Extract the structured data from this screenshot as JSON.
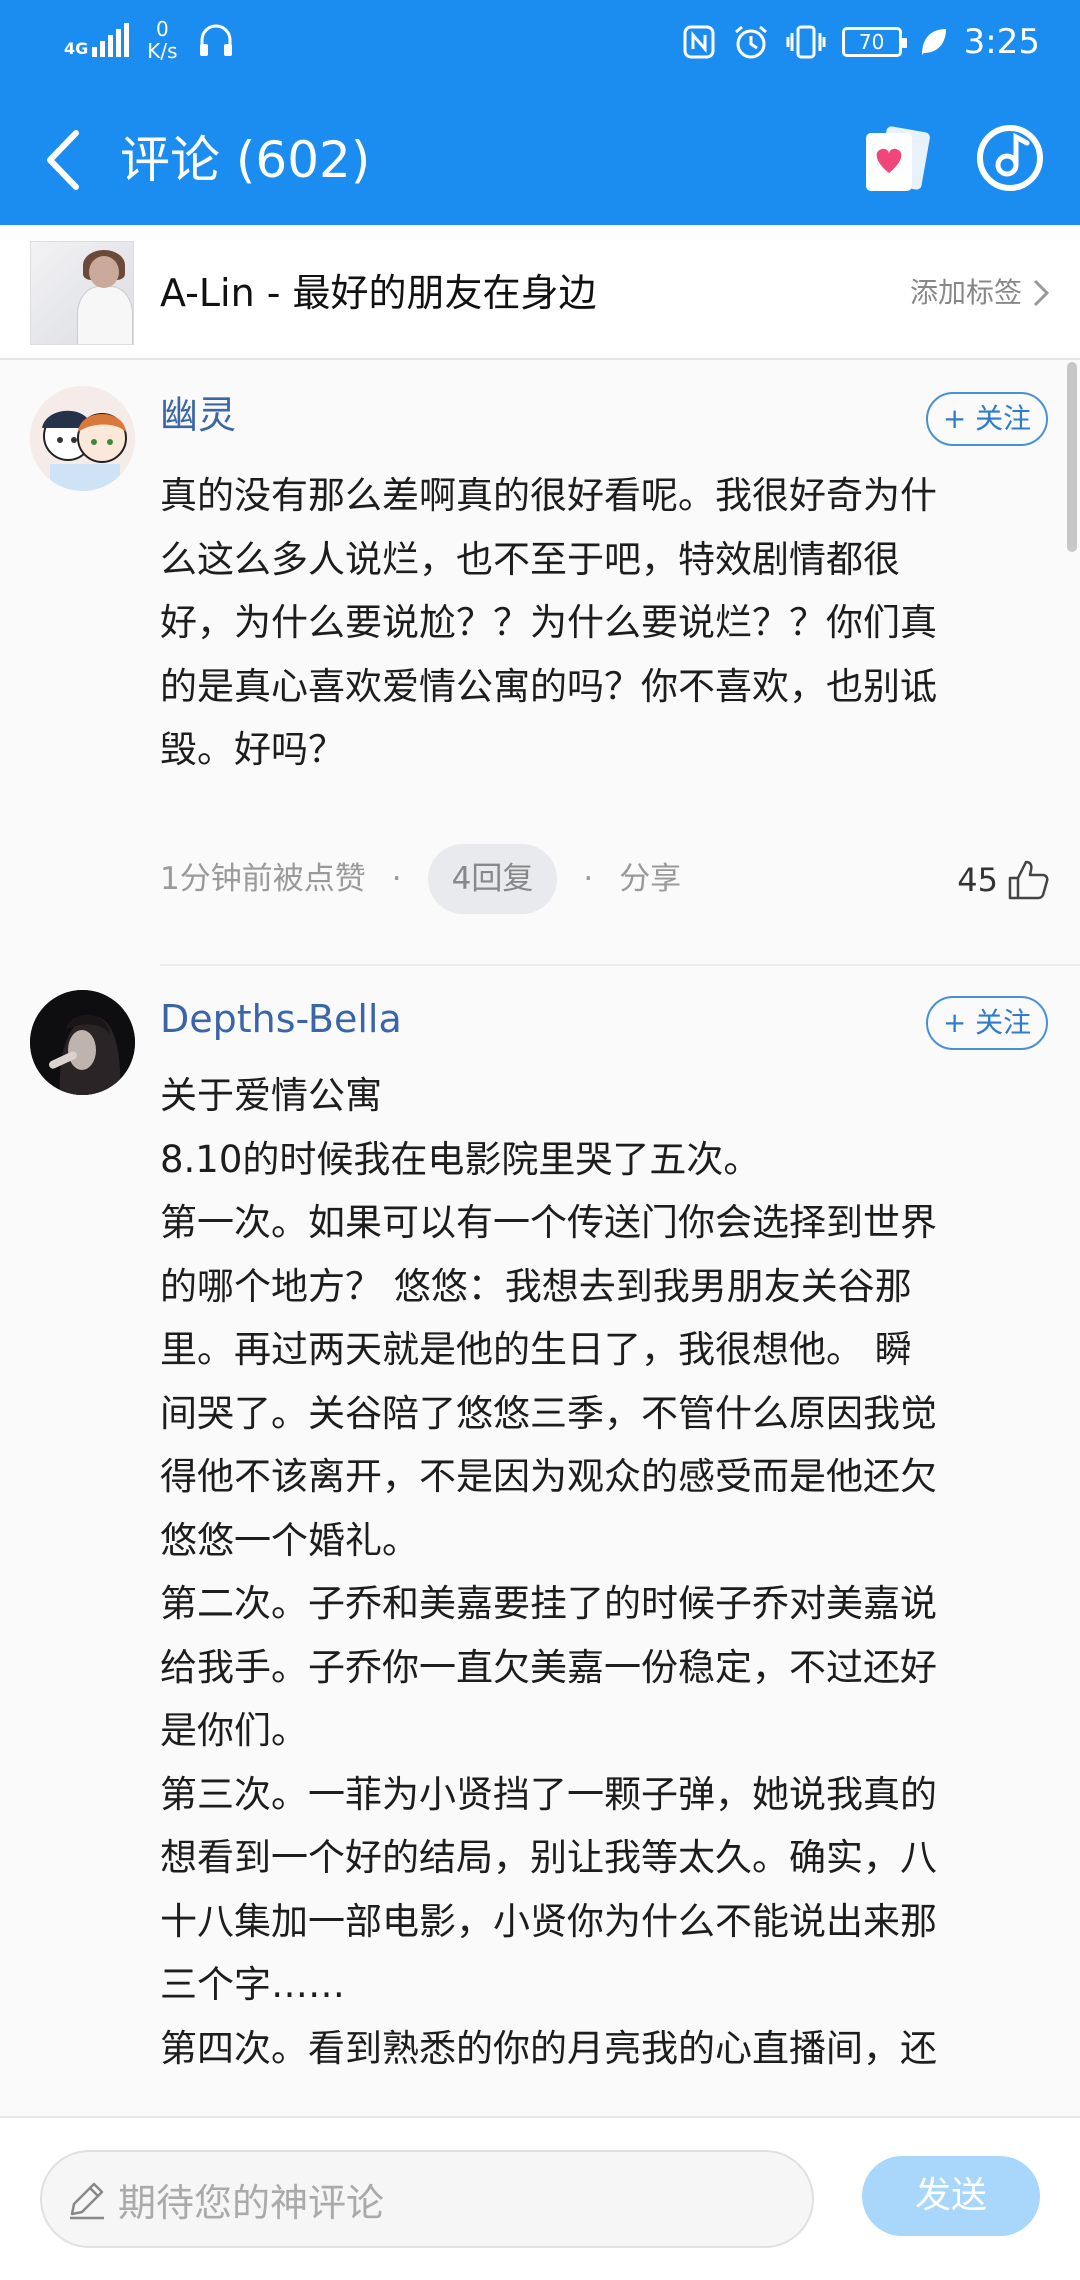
{
  "status_bar": {
    "network": "4G",
    "speed_value": "0",
    "speed_unit": "K/s",
    "battery": "70",
    "time": "3:25"
  },
  "header": {
    "title": "评论 (602)"
  },
  "song": {
    "title": "A-Lin - 最好的朋友在身边",
    "tag_label": "添加标签"
  },
  "comments": [
    {
      "username": "幽灵",
      "follow_label": "+ 关注",
      "lines": [
        "真的没有那么差啊真的很好看呢。我很好奇为什",
        "么这么多人说烂，也不至于吧，特效剧情都很",
        "好，为什么要说尬？？为什么要说烂？？你们真",
        "的是真心喜欢爱情公寓的吗？你不喜欢，也别诋",
        "毁。好吗？"
      ],
      "time": "1分钟前被点赞",
      "reply": "4回复",
      "share": "分享",
      "likes": "45"
    },
    {
      "username": "Depths-Bella",
      "follow_label": "+ 关注",
      "lines": [
        "关于爱情公寓",
        "8.10的时候我在电影院里哭了五次。",
        "第一次。如果可以有一个传送门你会选择到世界",
        "的哪个地方？ 悠悠：我想去到我男朋友关谷那",
        "里。再过两天就是他的生日了，我很想他。 瞬",
        "间哭了。关谷陪了悠悠三季，不管什么原因我觉",
        "得他不该离开，不是因为观众的感受而是他还欠",
        "悠悠一个婚礼。",
        "第二次。子乔和美嘉要挂了的时候子乔对美嘉说",
        "给我手。子乔你一直欠美嘉一份稳定，不过还好",
        "是你们。",
        "第三次。一菲为小贤挡了一颗子弹，她说我真的",
        "想看到一个好的结局，别让我等太久。确实，八",
        "十八集加一部电影，小贤你为什么不能说出来那",
        "三个字……",
        "第四次。看到熟悉的你的月亮我的心直播间，还"
      ]
    }
  ],
  "composer": {
    "placeholder": "期待您的神评论",
    "send_label": "发送"
  },
  "colors": {
    "header_bg": "#1b8cf0",
    "username": "#3a66a8",
    "send_disabled": "#a9d7fb"
  }
}
